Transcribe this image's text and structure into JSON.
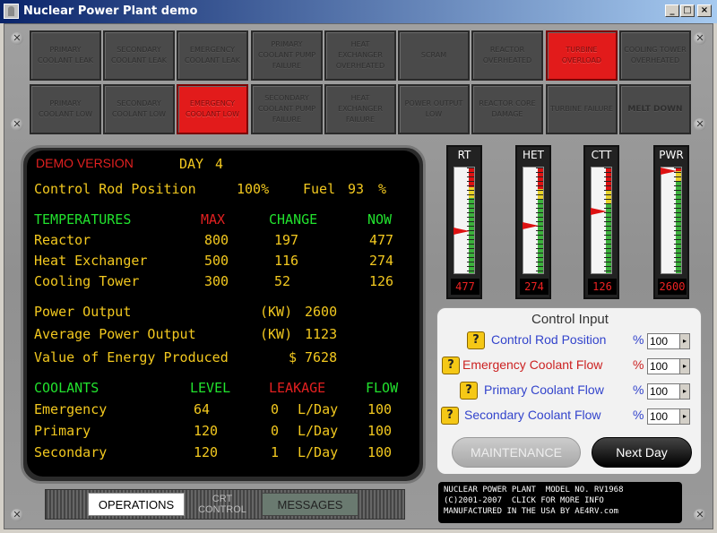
{
  "window": {
    "title": "Nuclear Power Plant demo",
    "min": "_",
    "max": "□",
    "close": "×"
  },
  "alarms_row1": [
    {
      "label": "PRIMARY COOLANT LEAK",
      "active": false
    },
    {
      "label": "SECONDARY COOLANT LEAK",
      "active": false
    },
    {
      "label": "EMERGENCY COOLANT LEAK",
      "active": false
    },
    {
      "label": "PRIMARY COOLANT PUMP FAILURE",
      "active": false
    },
    {
      "label": "HEAT EXCHANGER OVERHEATED",
      "active": false
    },
    {
      "label": "SCRAM",
      "active": false
    },
    {
      "label": "REACTOR OVERHEATED",
      "active": false
    },
    {
      "label": "TURBINE OVERLOAD",
      "active": true
    },
    {
      "label": "COOLING TOWER OVERHEATED",
      "active": false
    }
  ],
  "alarms_row2": [
    {
      "label": "PRIMARY COOLANT LOW",
      "active": false
    },
    {
      "label": "SECONDARY COOLANT LOW",
      "active": false
    },
    {
      "label": "EMERGENCY COOLANT LOW",
      "active": true
    },
    {
      "label": "SECONDARY COOLANT PUMP FAILURE",
      "active": false
    },
    {
      "label": "HEAT EXCHANGER FAILURE",
      "active": false
    },
    {
      "label": "POWER OUTPUT LOW",
      "active": false
    },
    {
      "label": "REACTOR CORE DAMAGE",
      "active": false
    },
    {
      "label": "TURBINE FAILURE",
      "active": false
    },
    {
      "label": "MELT DOWN",
      "active": false
    }
  ],
  "crt": {
    "demo": "DEMO VERSION",
    "day_label": "DAY",
    "day": "4",
    "rod_label": "Control Rod Position",
    "rod_value": "100%",
    "fuel_label": "Fuel",
    "fuel_value": "93",
    "fuel_unit": "%",
    "temps": {
      "header": "TEMPERATURES",
      "col_max": "MAX",
      "col_change": "CHANGE",
      "col_now": "NOW",
      "rows": [
        {
          "name": "Reactor",
          "max": "800",
          "change": "197",
          "now": "477"
        },
        {
          "name": "Heat Exchanger",
          "max": "500",
          "change": "116",
          "now": "274"
        },
        {
          "name": "Cooling Tower",
          "max": "300",
          "change": "52",
          "now": "126"
        }
      ]
    },
    "power_label": "Power Output",
    "power_unit": "(KW)",
    "power_value": "2600",
    "avg_label": "Average Power Output",
    "avg_unit": "(KW)",
    "avg_value": "1123",
    "energy_label": "Value of Energy Produced",
    "energy_unit": "$",
    "energy_value": "7628",
    "coolants": {
      "header": "COOLANTS",
      "col_level": "LEVEL",
      "col_leak": "LEAKAGE",
      "col_flow": "FLOW",
      "leak_unit": "L/Day",
      "rows": [
        {
          "name": "Emergency",
          "level": "64",
          "leak": "0",
          "flow": "100"
        },
        {
          "name": "Primary",
          "level": "120",
          "leak": "0",
          "flow": "100"
        },
        {
          "name": "Secondary",
          "level": "120",
          "leak": "1",
          "flow": "100"
        }
      ]
    }
  },
  "gauges": [
    {
      "label": "RT",
      "value": "477",
      "level": 0.4,
      "red": 0.18,
      "yellow": 0.1
    },
    {
      "label": "HET",
      "value": "274",
      "level": 0.45,
      "red": 0.2,
      "yellow": 0.1
    },
    {
      "label": "CTT",
      "value": "126",
      "level": 0.58,
      "red": 0.22,
      "yellow": 0.12
    },
    {
      "label": "PWR",
      "value": "2600",
      "level": 0.96,
      "red": 0.03,
      "yellow": 0.1
    }
  ],
  "control": {
    "title": "Control Input",
    "help": "?",
    "unit": "%",
    "arrow": "▸",
    "rows": [
      {
        "label": "Control Rod Position",
        "value": "100",
        "color": "#3344cc"
      },
      {
        "label": "Emergency Coolant Flow",
        "value": "100",
        "color": "#cc2222"
      },
      {
        "label": "Primary Coolant Flow",
        "value": "100",
        "color": "#3344cc"
      },
      {
        "label": "Secondary Coolant Flow",
        "value": "100",
        "color": "#3344cc"
      }
    ],
    "maintenance": "MAINTENANCE",
    "next_day": "Next Day"
  },
  "tabs": {
    "operations": "OPERATIONS",
    "crt_line1": "CRT",
    "crt_line2": "CONTROL",
    "messages": "MESSAGES"
  },
  "info_text": "NUCLEAR POWER PLANT  MODEL NO. RV1968\n(C)2001-2007  CLICK FOR MORE INFO\nMANUFACTURED IN THE USA BY AE4RV.com"
}
